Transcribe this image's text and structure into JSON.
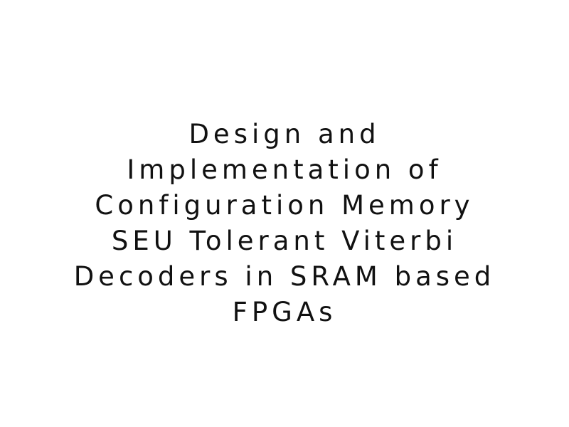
{
  "document": {
    "title_lines": [
      "Design and",
      "Implementation of",
      "Configuration Memory",
      "SEU Tolerant Viterbi",
      "Decoders in SRAM based",
      "FPGAs"
    ]
  }
}
